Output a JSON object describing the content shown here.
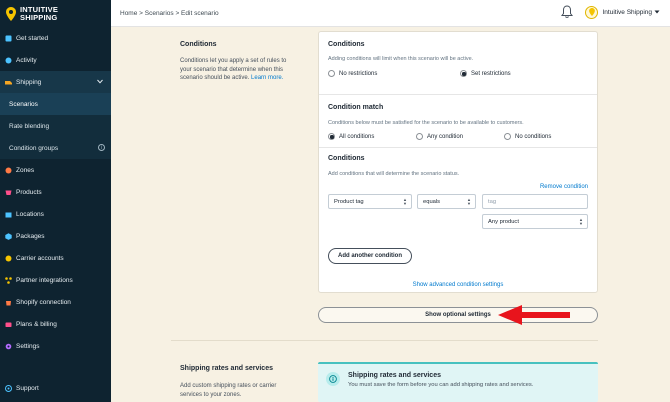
{
  "brand": {
    "name_line1": "INTUITIVE",
    "name_line2": "SHIPPING",
    "accent": "#f5c400"
  },
  "sidebar": {
    "items": [
      {
        "label": "Get started",
        "icon": "get-started-icon",
        "color": "#4cc3ff"
      },
      {
        "label": "Activity",
        "icon": "activity-icon",
        "color": "#4cc3ff"
      },
      {
        "label": "Shipping",
        "icon": "shipping-icon",
        "color": "#f5a623"
      },
      {
        "label": "Zones",
        "icon": "zones-icon",
        "color": "#ff7a45"
      },
      {
        "label": "Products",
        "icon": "products-icon",
        "color": "#ff4f8b"
      },
      {
        "label": "Locations",
        "icon": "locations-icon",
        "color": "#4cc3ff"
      },
      {
        "label": "Packages",
        "icon": "packages-icon",
        "color": "#4cc3ff"
      },
      {
        "label": "Carrier accounts",
        "icon": "carrier-accounts-icon",
        "color": "#f5c400"
      },
      {
        "label": "Partner integrations",
        "icon": "partner-integrations-icon",
        "color": "#f5c400"
      },
      {
        "label": "Shopify connection",
        "icon": "shopify-connection-icon",
        "color": "#ff7a45"
      },
      {
        "label": "Plans & billing",
        "icon": "plans-billing-icon",
        "color": "#ff4f8b"
      },
      {
        "label": "Settings",
        "icon": "settings-icon",
        "color": "#b36bff"
      }
    ],
    "sub_items": [
      {
        "label": "Scenarios"
      },
      {
        "label": "Rate blending"
      },
      {
        "label": "Condition groups"
      }
    ],
    "support_label": "Support"
  },
  "topbar": {
    "breadcrumb": "Home > Scenarios > Edit scenario",
    "user_name": "Intuitive Shipping"
  },
  "conditions_section": {
    "title": "Conditions",
    "description": "Conditions let you apply a set of rules to your scenario that determine when this scenario should be active.",
    "learn_more": "Learn more."
  },
  "card": {
    "conditions_title": "Conditions",
    "conditions_sub": "Adding conditions will limit when this scenario will be active.",
    "no_restrictions": "No restrictions",
    "set_restrictions": "Set restrictions",
    "match_title": "Condition match",
    "match_sub": "Conditions below must be satisfied for the scenario to be available to customers.",
    "all_conditions": "All conditions",
    "any_condition": "Any condition",
    "no_conditions": "No conditions",
    "list_title": "Conditions",
    "list_sub": "Add conditions that will determine the scenario status.",
    "remove_condition": "Remove condition",
    "field_select": "Product tag",
    "operator_select": "equals",
    "tag_placeholder": "tag",
    "scope_select": "Any product",
    "add_button": "Add another condition",
    "advanced_link": "Show advanced condition settings"
  },
  "optional_button": "Show optional settings",
  "rates_section": {
    "title": "Shipping rates and services",
    "description": "Add custom shipping rates or carrier services to your zones.",
    "info_title": "Shipping rates and services",
    "info_text": "You must save the form before you can add shipping rates and services."
  }
}
